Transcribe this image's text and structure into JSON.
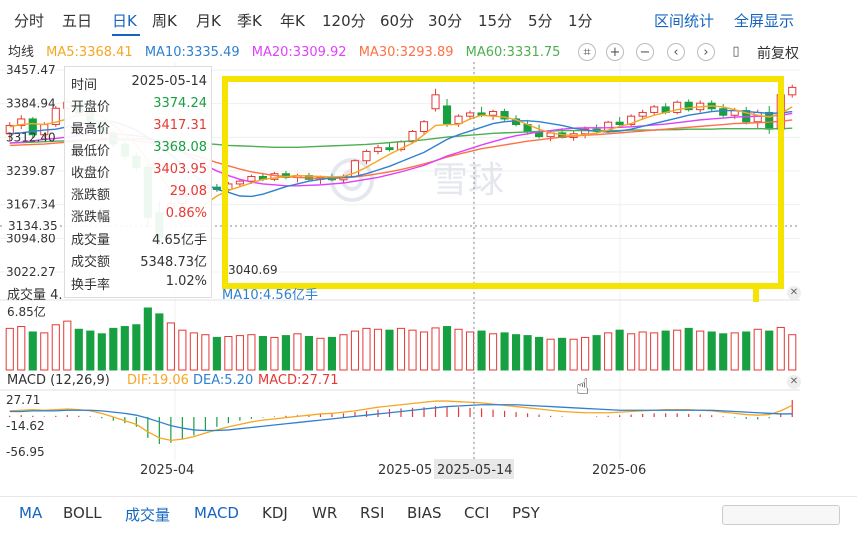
{
  "periods": [
    "分时",
    "五日",
    "日K",
    "周K",
    "月K",
    "季K",
    "年K",
    "120分",
    "60分",
    "30分",
    "15分",
    "5分",
    "1分"
  ],
  "active_period": "日K",
  "range_stats_label": "区间统计",
  "fullscreen_label": "全屏显示",
  "ma_line": {
    "label": "均线",
    "ma5": "MA5:3368.41",
    "ma10": "MA10:3335.49",
    "ma20": "MA20:3309.92",
    "ma30": "MA30:3293.89",
    "ma60": "MA60:3331.75"
  },
  "fq_label": "前复权",
  "colors": {
    "up": "#e53935",
    "down": "#17a041",
    "ma5": "#f5a623",
    "ma10": "#2f80d1",
    "ma20": "#e040fb",
    "ma30": "#ff7043",
    "ma60": "#4caf50",
    "highlight": "#f5e400",
    "accent": "#1565c0"
  },
  "info_panel": {
    "time_k": "时间",
    "time_v": "2025-05-14",
    "open_k": "开盘价",
    "open_v": "3374.24",
    "high_k": "最高价",
    "high_v": "3417.31",
    "low_k": "最低价",
    "low_v": "3368.08",
    "close_k": "收盘价",
    "close_v": "3403.95",
    "chg_k": "涨跌额",
    "chg_v": "29.08",
    "pct_k": "涨跌幅",
    "pct_v": "0.86%",
    "vol_k": "成交量",
    "vol_v": "4.65亿手",
    "amt_k": "成交额",
    "amt_v": "5348.73亿",
    "turn_k": "换手率",
    "turn_v": "1.02%"
  },
  "volume_label": "成交量 4.",
  "volume_ma_label": "MA10:4.56亿手",
  "volume_max_label": "6.85亿",
  "macd_label": "MACD (12,26,9)",
  "macd_dif": "DIF:19.06",
  "macd_dea": "DEA:5.20",
  "macd_val": "MACD:27.71",
  "cursor_date_label": "2025-05-14",
  "low_marker_label": "3040.69",
  "watermark": "雪球",
  "bottom_tabs": [
    "MA",
    "BOLL",
    "成交量",
    "MACD",
    "KDJ",
    "WR",
    "RSI",
    "BIAS",
    "CCI",
    "PSY"
  ],
  "active_indicator": "成交量",
  "chart_data": [
    {
      "type": "candlestick",
      "x_tick_labels": [
        "2025-04",
        "2025-05",
        "2025-06"
      ],
      "y_tick_labels": [
        "3457.47",
        "3384.94",
        "3312.40",
        "3239.87",
        "3167.34",
        "3094.80",
        "3022.27"
      ],
      "ylim": [
        3022.27,
        3457.47
      ],
      "cursor_price_label": "3134.35",
      "ohlc": [
        [
          3320,
          3345,
          3305,
          3338
        ],
        [
          3338,
          3360,
          3330,
          3352
        ],
        [
          3352,
          3356,
          3310,
          3318
        ],
        [
          3318,
          3345,
          3312,
          3340
        ],
        [
          3340,
          3380,
          3335,
          3375
        ],
        [
          3375,
          3395,
          3368,
          3388
        ],
        [
          3388,
          3392,
          3360,
          3365
        ],
        [
          3365,
          3372,
          3340,
          3348
        ],
        [
          3348,
          3352,
          3310,
          3322
        ],
        [
          3322,
          3330,
          3290,
          3298
        ],
        [
          3298,
          3305,
          3265,
          3272
        ],
        [
          3272,
          3280,
          3240,
          3248
        ],
        [
          3248,
          3255,
          3120,
          3140
        ],
        [
          3150,
          3175,
          3080,
          3096
        ],
        [
          3160,
          3180,
          3150,
          3170
        ],
        [
          3170,
          3192,
          3163,
          3188
        ],
        [
          3188,
          3198,
          3180,
          3193
        ],
        [
          3193,
          3210,
          3186,
          3205
        ],
        [
          3205,
          3212,
          3195,
          3200
        ],
        [
          3200,
          3216,
          3195,
          3212
        ],
        [
          3212,
          3222,
          3206,
          3218
        ],
        [
          3218,
          3232,
          3212,
          3228
        ],
        [
          3228,
          3236,
          3218,
          3222
        ],
        [
          3222,
          3238,
          3218,
          3234
        ],
        [
          3234,
          3240,
          3222,
          3226
        ],
        [
          3226,
          3234,
          3215,
          3230
        ],
        [
          3230,
          3236,
          3218,
          3222
        ],
        [
          3222,
          3230,
          3212,
          3226
        ],
        [
          3226,
          3234,
          3218,
          3221
        ],
        [
          3221,
          3232,
          3214,
          3228
        ],
        [
          3228,
          3265,
          3226,
          3262
        ],
        [
          3262,
          3286,
          3255,
          3282
        ],
        [
          3282,
          3296,
          3276,
          3290
        ],
        [
          3290,
          3300,
          3282,
          3286
        ],
        [
          3286,
          3306,
          3282,
          3303
        ],
        [
          3303,
          3328,
          3300,
          3325
        ],
        [
          3325,
          3350,
          3318,
          3346
        ],
        [
          3374,
          3417,
          3368,
          3404
        ],
        [
          3380,
          3395,
          3335,
          3342
        ],
        [
          3342,
          3362,
          3335,
          3358
        ],
        [
          3358,
          3370,
          3350,
          3365
        ],
        [
          3365,
          3378,
          3356,
          3360
        ],
        [
          3360,
          3372,
          3350,
          3368
        ],
        [
          3368,
          3374,
          3348,
          3352
        ],
        [
          3352,
          3360,
          3336,
          3340
        ],
        [
          3340,
          3350,
          3318,
          3325
        ],
        [
          3325,
          3340,
          3310,
          3314
        ],
        [
          3314,
          3328,
          3304,
          3322
        ],
        [
          3322,
          3332,
          3310,
          3312
        ],
        [
          3312,
          3326,
          3305,
          3320
        ],
        [
          3320,
          3336,
          3310,
          3330
        ],
        [
          3330,
          3340,
          3320,
          3326
        ],
        [
          3326,
          3348,
          3322,
          3345
        ],
        [
          3345,
          3356,
          3336,
          3340
        ],
        [
          3340,
          3362,
          3336,
          3358
        ],
        [
          3358,
          3372,
          3350,
          3366
        ],
        [
          3366,
          3382,
          3360,
          3378
        ],
        [
          3378,
          3386,
          3362,
          3366
        ],
        [
          3366,
          3392,
          3362,
          3388
        ],
        [
          3388,
          3394,
          3368,
          3372
        ],
        [
          3372,
          3392,
          3366,
          3386
        ],
        [
          3386,
          3392,
          3368,
          3374
        ],
        [
          3374,
          3384,
          3356,
          3360
        ],
        [
          3360,
          3376,
          3352,
          3370
        ],
        [
          3370,
          3378,
          3340,
          3346
        ],
        [
          3346,
          3372,
          3330,
          3366
        ],
        [
          3366,
          3380,
          3320,
          3330
        ],
        [
          3330,
          3410,
          3328,
          3404
        ],
        [
          3404,
          3426,
          3398,
          3420
        ]
      ],
      "ma5": [
        3335,
        3340,
        3342,
        3340,
        3345,
        3352,
        3360,
        3362,
        3358,
        3340,
        3318,
        3296,
        3262,
        3232,
        3198,
        3164,
        3150,
        3168,
        3186,
        3198,
        3206,
        3214,
        3222,
        3225,
        3228,
        3230,
        3229,
        3228,
        3227,
        3228,
        3236,
        3248,
        3262,
        3276,
        3288,
        3300,
        3318,
        3338,
        3340,
        3340,
        3352,
        3360,
        3358,
        3356,
        3350,
        3340,
        3330,
        3322,
        3318,
        3316,
        3318,
        3322,
        3328,
        3336,
        3342,
        3352,
        3360,
        3366,
        3372,
        3376,
        3378,
        3380,
        3378,
        3372,
        3365,
        3360,
        3356,
        3364,
        3378
      ],
      "ma10": [
        3320,
        3322,
        3325,
        3328,
        3330,
        3335,
        3340,
        3345,
        3348,
        3346,
        3338,
        3328,
        3312,
        3295,
        3275,
        3254,
        3232,
        3212,
        3200,
        3194,
        3186,
        3185,
        3190,
        3198,
        3206,
        3212,
        3218,
        3222,
        3225,
        3226,
        3228,
        3234,
        3242,
        3250,
        3260,
        3270,
        3280,
        3294,
        3308,
        3318,
        3326,
        3334,
        3342,
        3346,
        3348,
        3348,
        3346,
        3342,
        3338,
        3332,
        3328,
        3325,
        3324,
        3326,
        3330,
        3336,
        3342,
        3348,
        3354,
        3360,
        3364,
        3368,
        3370,
        3370,
        3368,
        3366,
        3364,
        3365,
        3368
      ],
      "ma20": [
        3300,
        3302,
        3305,
        3308,
        3310,
        3313,
        3316,
        3318,
        3320,
        3320,
        3318,
        3316,
        3312,
        3304,
        3292,
        3280,
        3266,
        3252,
        3240,
        3230,
        3222,
        3216,
        3212,
        3210,
        3208,
        3208,
        3209,
        3210,
        3212,
        3214,
        3218,
        3222,
        3226,
        3232,
        3238,
        3245,
        3252,
        3262,
        3272,
        3280,
        3288,
        3296,
        3303,
        3310,
        3316,
        3320,
        3324,
        3327,
        3330,
        3332,
        3333,
        3333,
        3333,
        3334,
        3335,
        3337,
        3339,
        3341,
        3344,
        3347,
        3350,
        3352,
        3354,
        3356,
        3357,
        3358,
        3358,
        3360,
        3364
      ],
      "ma30": [
        3295,
        3296,
        3297,
        3298,
        3300,
        3302,
        3304,
        3306,
        3307,
        3308,
        3307,
        3305,
        3302,
        3297,
        3290,
        3282,
        3274,
        3266,
        3258,
        3251,
        3244,
        3238,
        3234,
        3230,
        3228,
        3226,
        3225,
        3224,
        3224,
        3225,
        3227,
        3230,
        3234,
        3238,
        3243,
        3249,
        3255,
        3262,
        3270,
        3276,
        3282,
        3288,
        3292,
        3296,
        3300,
        3304,
        3307,
        3310,
        3313,
        3315,
        3317,
        3318,
        3320,
        3322,
        3324,
        3326,
        3328,
        3330,
        3332,
        3334,
        3336,
        3338,
        3340,
        3342,
        3343,
        3344,
        3345,
        3347,
        3350
      ],
      "ma60": [
        3300,
        3301,
        3302,
        3303,
        3304,
        3305,
        3306,
        3307,
        3308,
        3309,
        3309,
        3309,
        3308,
        3307,
        3305,
        3303,
        3301,
        3299,
        3297,
        3295,
        3294,
        3293,
        3292,
        3291,
        3291,
        3291,
        3292,
        3293,
        3294,
        3295,
        3296,
        3297,
        3299,
        3301,
        3303,
        3305,
        3307,
        3310,
        3313,
        3315,
        3317,
        3319,
        3321,
        3322,
        3323,
        3324,
        3325,
        3326,
        3327,
        3327,
        3327,
        3327,
        3327,
        3327,
        3328,
        3328,
        3328,
        3329,
        3329,
        3330,
        3330,
        3330,
        3331,
        3331,
        3331,
        3331,
        3331,
        3331,
        3332
      ]
    },
    {
      "type": "bar",
      "name": "volume",
      "unit": "亿手",
      "max_label": "6.85亿",
      "values": [
        4.6,
        4.8,
        4.2,
        4.1,
        5.0,
        5.4,
        4.5,
        4.3,
        4.0,
        4.6,
        4.8,
        5.0,
        6.85,
        6.2,
        5.2,
        4.4,
        4.1,
        3.9,
        3.6,
        3.7,
        3.8,
        3.9,
        3.7,
        3.6,
        3.8,
        4.0,
        3.7,
        3.5,
        3.6,
        3.9,
        4.3,
        4.6,
        4.5,
        4.4,
        4.6,
        4.4,
        4.2,
        4.65,
        4.8,
        4.5,
        4.2,
        4.3,
        4.0,
        4.1,
        3.9,
        3.8,
        3.6,
        3.4,
        3.5,
        3.4,
        3.6,
        3.8,
        4.1,
        4.4,
        4.0,
        4.2,
        4.1,
        4.3,
        4.4,
        4.6,
        4.3,
        4.2,
        4.0,
        4.1,
        4.2,
        4.5,
        4.3,
        4.7,
        3.9
      ]
    },
    {
      "type": "bar+line",
      "name": "MACD",
      "y_tick_labels": [
        "27.71",
        "-14.62",
        "-56.95"
      ],
      "ylim": [
        -56.95,
        27.71
      ],
      "macd": [
        2,
        3,
        2,
        1,
        2,
        3,
        2,
        1,
        -2,
        -6,
        -10,
        -16,
        -34,
        -44,
        -42,
        -36,
        -30,
        -22,
        -16,
        -10,
        -6,
        -3,
        -1,
        1,
        2,
        3,
        4,
        5,
        5,
        6,
        8,
        10,
        12,
        13,
        14,
        15,
        16,
        18,
        17,
        16,
        15,
        14,
        12,
        10,
        8,
        6,
        4,
        2,
        1,
        0,
        0,
        1,
        2,
        3,
        4,
        5,
        6,
        6,
        6,
        5,
        4,
        3,
        1,
        -1,
        -3,
        -4,
        -2,
        6,
        27.71
      ],
      "dif": [
        10,
        11,
        12,
        11,
        12,
        13,
        12,
        10,
        6,
        0,
        -6,
        -12,
        -24,
        -34,
        -38,
        -36,
        -32,
        -26,
        -21,
        -16,
        -12,
        -8,
        -5,
        -3,
        -1,
        1,
        3,
        5,
        6,
        8,
        10,
        13,
        16,
        18,
        20,
        22,
        24,
        26,
        26,
        25,
        24,
        23,
        21,
        19,
        17,
        15,
        13,
        11,
        9,
        8,
        7,
        7,
        7,
        8,
        9,
        10,
        11,
        12,
        12,
        12,
        11,
        10,
        8,
        6,
        4,
        3,
        4,
        10,
        19.06
      ],
      "dea": [
        9,
        9,
        10,
        10,
        10,
        11,
        11,
        11,
        10,
        8,
        6,
        3,
        -2,
        -8,
        -14,
        -18,
        -21,
        -22,
        -22,
        -21,
        -19,
        -17,
        -15,
        -13,
        -11,
        -9,
        -7,
        -5,
        -3,
        -1,
        1,
        3,
        5,
        7,
        9,
        11,
        13,
        15,
        17,
        18,
        19,
        20,
        20,
        20,
        20,
        19,
        18,
        17,
        16,
        15,
        14,
        13,
        12,
        11,
        11,
        11,
        11,
        11,
        11,
        11,
        11,
        11,
        10,
        9,
        8,
        7,
        6,
        5,
        5.2
      ]
    }
  ]
}
